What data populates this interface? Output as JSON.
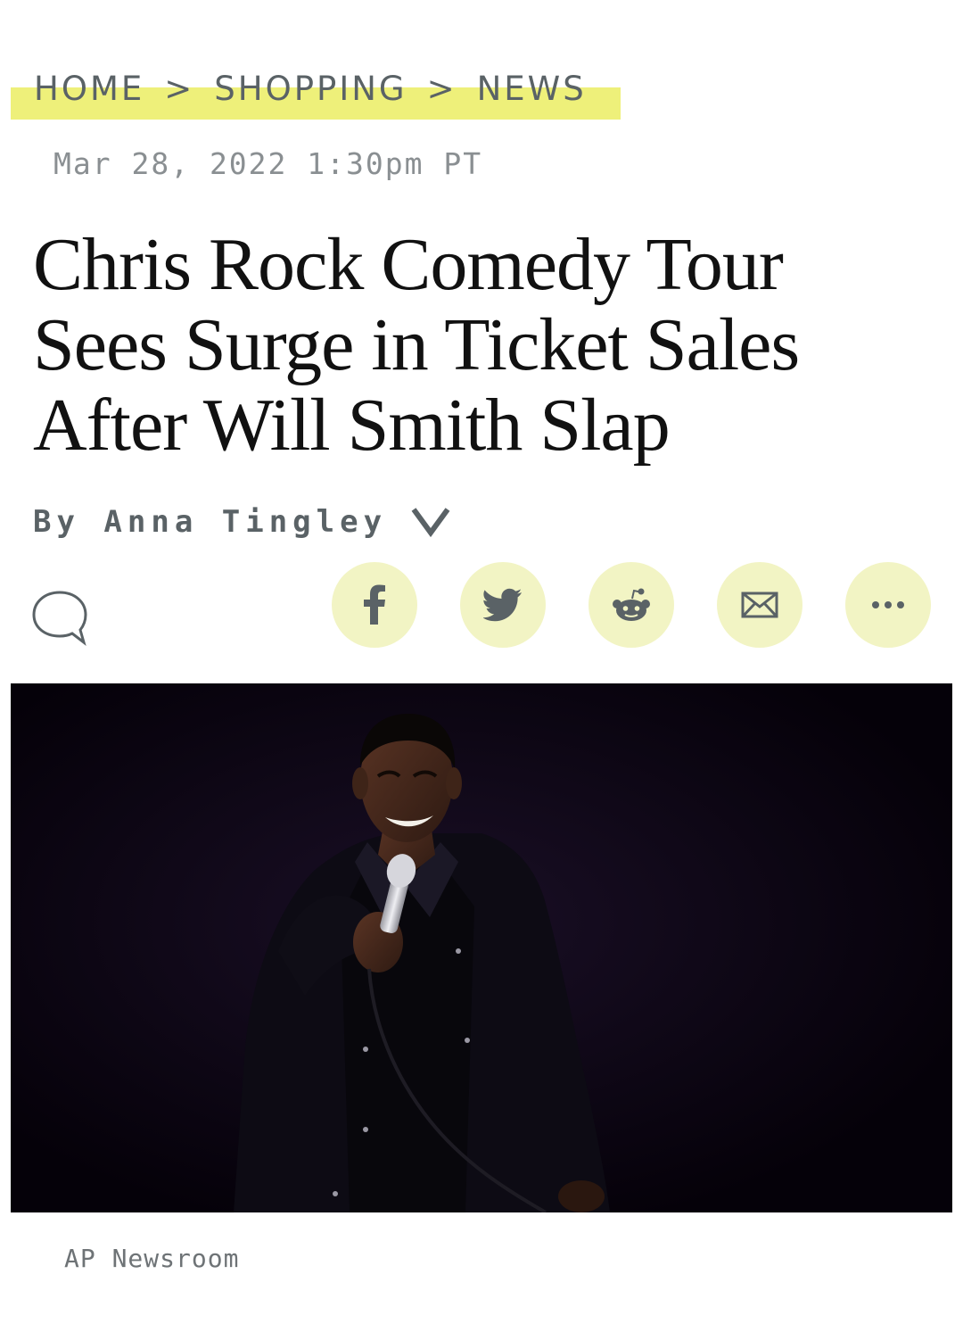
{
  "breadcrumb": {
    "items": [
      "HOME",
      "SHOPPING",
      "NEWS"
    ],
    "separator": ">",
    "highlight_color": "#eef07a"
  },
  "article": {
    "timestamp": "Mar 28, 2022 1:30pm PT",
    "headline_lines": [
      "Chris Rock Comedy Tour",
      "Sees Surge in Ticket Sales",
      "After Will Smith Slap"
    ],
    "byline": "By Anna Tingley",
    "byline_toggle_icon": "chevron-down-icon"
  },
  "actions": {
    "comment_icon": "speech-bubble-icon",
    "share_buttons": [
      {
        "name": "facebook",
        "icon": "facebook-icon"
      },
      {
        "name": "twitter",
        "icon": "twitter-icon"
      },
      {
        "name": "reddit",
        "icon": "reddit-icon"
      },
      {
        "name": "email",
        "icon": "envelope-icon"
      },
      {
        "name": "more",
        "icon": "more-dots-icon"
      }
    ],
    "share_button_color": "#f2f4c4"
  },
  "hero_image": {
    "subject": "comedian holding microphone on dark stage",
    "background_color": "#07020c"
  },
  "caption": {
    "credit": "AP Newsroom"
  }
}
